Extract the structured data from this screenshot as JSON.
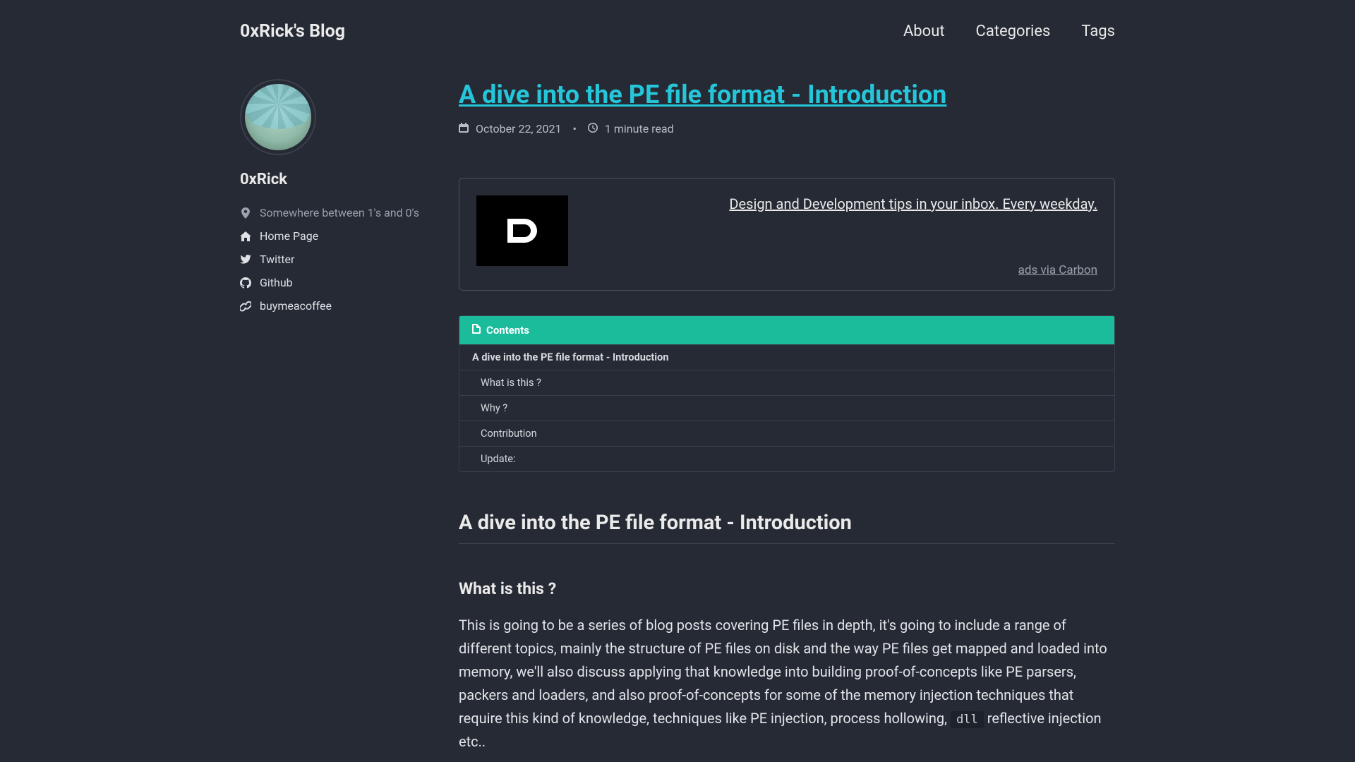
{
  "header": {
    "brand": "0xRick's Blog",
    "nav": [
      "About",
      "Categories",
      "Tags"
    ]
  },
  "sidebar": {
    "name": "0xRick",
    "location": "Somewhere between 1's and 0's",
    "links": [
      {
        "icon": "home",
        "label": "Home Page"
      },
      {
        "icon": "twitter",
        "label": "Twitter"
      },
      {
        "icon": "github",
        "label": "Github"
      },
      {
        "icon": "link",
        "label": "buymeacoffee"
      }
    ]
  },
  "post": {
    "title": "A dive into the PE file format - Introduction",
    "date": "October 22, 2021",
    "read_time": "1 minute read"
  },
  "ad": {
    "text": "Design and Development tips in your inbox. Every weekday.",
    "attrib": "ads via Carbon"
  },
  "toc": {
    "header": "Contents",
    "items": [
      {
        "label": "A dive into the PE file format - Introduction",
        "level": 0
      },
      {
        "label": "What is this ?",
        "level": 1
      },
      {
        "label": "Why ?",
        "level": 1
      },
      {
        "label": "Contribution",
        "level": 1
      },
      {
        "label": "Update:",
        "level": 1
      }
    ]
  },
  "article": {
    "h1": "A dive into the PE file format - Introduction",
    "h2": "What is this ?",
    "p1a": "This is going to be a series of blog posts covering PE files in depth, it's going to include a range of different topics, mainly the structure of PE files on disk and the way PE files get mapped and loaded into memory, we'll also discuss applying that knowledge into building proof-of-concepts like PE parsers, packers and loaders, and also proof-of-concepts for some of the memory injection techniques that require this kind of knowledge, techniques like PE injection, process hollowing, ",
    "code1": "dll",
    "p1b": " reflective injection etc.."
  }
}
